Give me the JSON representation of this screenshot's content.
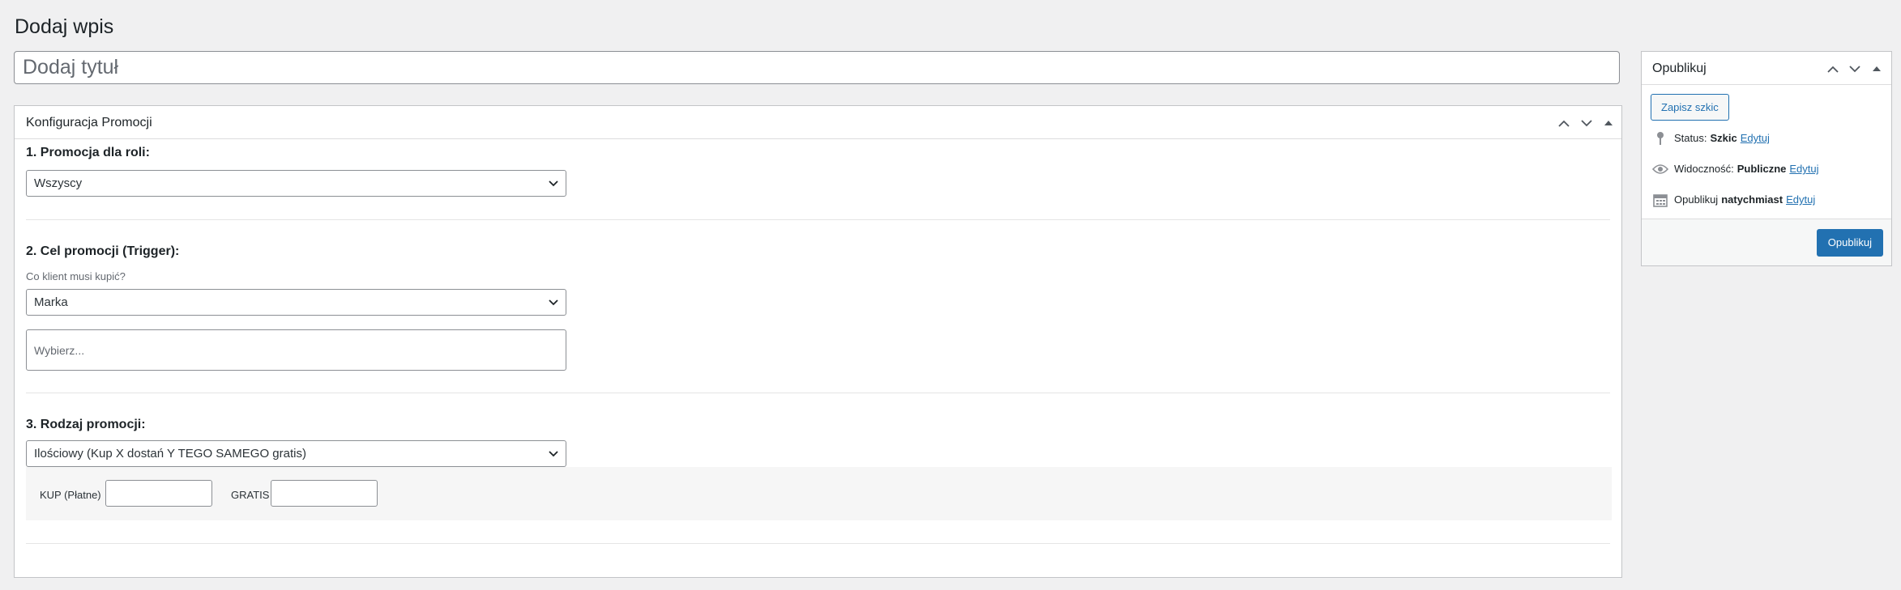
{
  "page": {
    "title": "Dodaj wpis",
    "title_placeholder": "Dodaj tytuł"
  },
  "promo_box": {
    "heading": "Konfiguracja Promocji",
    "section1": {
      "label": "1. Promocja dla roli:",
      "select_value": "Wszyscy"
    },
    "section2": {
      "label": "2. Cel promocji (Trigger):",
      "description": "Co klient musi kupić?",
      "select_value": "Marka",
      "picker_placeholder": "Wybierz..."
    },
    "section3": {
      "label": "3. Rodzaj promocji:",
      "select_value": "Ilościowy (Kup X dostań Y TEGO SAMEGO gratis)",
      "buy_label": "KUP (Płatne)",
      "free_label": "GRATIS"
    }
  },
  "publish_box": {
    "heading": "Opublikuj",
    "save_draft": "Zapisz szkic",
    "status_label": "Status:",
    "status_value": "Szkic",
    "visibility_label": "Widoczność:",
    "visibility_value": "Publiczne",
    "publish_label": "Opublikuj",
    "publish_value": "natychmiast",
    "edit_label": "Edytuj",
    "publish_button": "Opublikuj"
  },
  "icons": {
    "move_up": "chevron-up-icon",
    "move_down": "chevron-down-icon",
    "toggle": "triangle-up-icon",
    "status": "pin-icon",
    "visibility": "eye-icon",
    "schedule": "calendar-icon"
  },
  "colors": {
    "accent": "#2271b1",
    "background": "#f0f0f1"
  }
}
